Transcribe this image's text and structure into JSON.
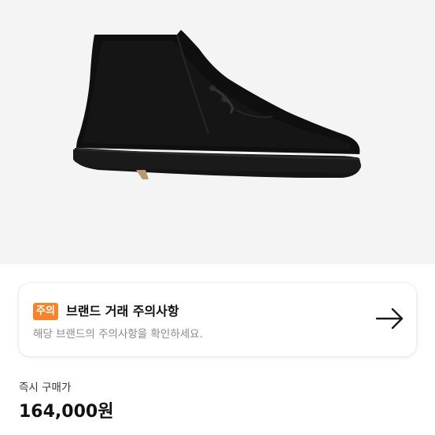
{
  "product": {
    "image_icon": "suede-chukka-boot-icon"
  },
  "notice": {
    "badge": "주의",
    "title": "브랜드 거래 주의사항",
    "description": "해당 브랜드의 주의사항을 확인하세요.",
    "arrow_icon": "arrow-right-icon",
    "badge_color": "#f5842a"
  },
  "purchase": {
    "label": "즉시 구매가",
    "price": "164,000원"
  }
}
